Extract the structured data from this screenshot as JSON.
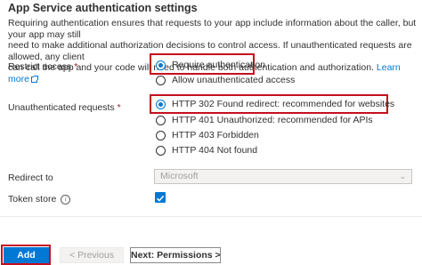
{
  "section": {
    "title": "App Service authentication settings",
    "description_lines": [
      "Requiring authentication ensures that requests to your app include information about the caller, but your app may still",
      "need to make additional authorization decisions to control access. If unauthenticated requests are allowed, any client",
      "can call the app and your code will need to handle both authentication and authorization."
    ],
    "learn_more": "Learn more"
  },
  "restrict_access": {
    "label": "Restrict access",
    "required_mark": "*",
    "options": [
      {
        "label": "Require authentication",
        "selected": true
      },
      {
        "label": "Allow unauthenticated access",
        "selected": false
      }
    ]
  },
  "unauthenticated_requests": {
    "label": "Unauthenticated requests",
    "required_mark": "*",
    "options": [
      {
        "label": "HTTP 302 Found redirect: recommended for websites",
        "selected": true
      },
      {
        "label": "HTTP 401 Unauthorized: recommended for APIs",
        "selected": false
      },
      {
        "label": "HTTP 403 Forbidden",
        "selected": false
      },
      {
        "label": "HTTP 404 Not found",
        "selected": false
      }
    ]
  },
  "redirect_to": {
    "label": "Redirect to",
    "value": "Microsoft",
    "disabled": true
  },
  "token_store": {
    "label": "Token store",
    "checked": true
  },
  "footer": {
    "add": "Add",
    "previous": "< Previous",
    "next": "Next: Permissions >"
  },
  "colors": {
    "accent": "#0078d4",
    "highlight": "#c50f1f",
    "required": "#a4262c"
  },
  "icons": [
    "external-link-icon",
    "info-icon",
    "chevron-down-icon",
    "checkmark-icon"
  ]
}
